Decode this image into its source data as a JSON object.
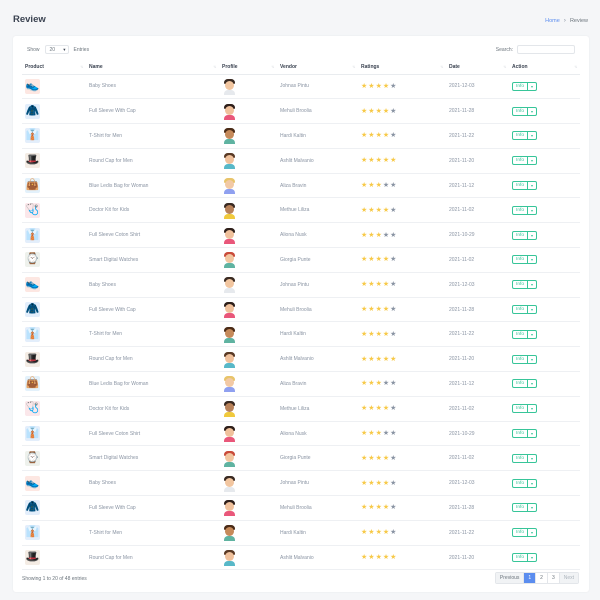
{
  "header": {
    "title": "Review",
    "breadcrumb_home": "Home",
    "breadcrumb_current": "Review"
  },
  "controls": {
    "show_label": "Show",
    "entries_label": "Entries",
    "page_size": "20",
    "search_label": "Search:"
  },
  "table": {
    "columns": [
      "Product",
      "Name",
      "Profile",
      "Vendor",
      "Ratings",
      "Date",
      "Action"
    ],
    "rows": [
      {
        "name": "Baby Shoes",
        "vendor": "Johnas Pintu",
        "rating": 4,
        "date": "2021-12-03",
        "product_icon": "shoe-icon",
        "avatar_icon": "man-beard-icon",
        "action": "Info"
      },
      {
        "name": "Full Sleeve With Cap",
        "vendor": "Mehuli Broolia",
        "rating": 4,
        "date": "2021-11-28",
        "product_icon": "hoodie-icon",
        "avatar_icon": "woman-icon",
        "action": "Info"
      },
      {
        "name": "T-Shirt for Men",
        "vendor": "Hardi Kaltin",
        "rating": 4,
        "date": "2021-11-22",
        "product_icon": "shirt-icon",
        "avatar_icon": "woman-curly-icon",
        "action": "Info"
      },
      {
        "name": "Round Cap for Men",
        "vendor": "Ashlit Malvanio",
        "rating": 5,
        "date": "2021-11-20",
        "product_icon": "hat-icon",
        "avatar_icon": "man-icon",
        "action": "Info"
      },
      {
        "name": "Blue Ledis Bag for Woman",
        "vendor": "Aliza Bravin",
        "rating": 3,
        "date": "2021-11-12",
        "product_icon": "bag-icon",
        "avatar_icon": "woman-blonde-icon",
        "action": "Info"
      },
      {
        "name": "Doctor Kit for Kids",
        "vendor": "Methue Liliza",
        "rating": 4,
        "date": "2021-11-02",
        "product_icon": "stethoscope-icon",
        "avatar_icon": "man-yellow-icon",
        "action": "Info"
      },
      {
        "name": "Full Sleeve Coton Shirt",
        "vendor": "Aliona Nusk",
        "rating": 3,
        "date": "2021-10-29",
        "product_icon": "shirt-icon",
        "avatar_icon": "woman-icon",
        "action": "Info"
      },
      {
        "name": "Smart Digital Watches",
        "vendor": "Giorgia Punte",
        "rating": 4,
        "date": "2021-11-02",
        "product_icon": "watch-icon",
        "avatar_icon": "man-red-icon",
        "action": "Info"
      },
      {
        "name": "Baby Shoes",
        "vendor": "Johnas Pintu",
        "rating": 4,
        "date": "2021-12-03",
        "product_icon": "shoe-icon",
        "avatar_icon": "man-beard-icon",
        "action": "Info"
      },
      {
        "name": "Full Sleeve With Cap",
        "vendor": "Mehuli Broolia",
        "rating": 4,
        "date": "2021-11-28",
        "product_icon": "hoodie-icon",
        "avatar_icon": "woman-icon",
        "action": "Info"
      },
      {
        "name": "T-Shirt for Men",
        "vendor": "Hardi Kaltin",
        "rating": 4,
        "date": "2021-11-22",
        "product_icon": "shirt-icon",
        "avatar_icon": "woman-curly-icon",
        "action": "Info"
      },
      {
        "name": "Round Cap for Men",
        "vendor": "Ashlit Malvanio",
        "rating": 5,
        "date": "2021-11-20",
        "product_icon": "hat-icon",
        "avatar_icon": "man-icon",
        "action": "Info"
      },
      {
        "name": "Blue Ledis Bag for Woman",
        "vendor": "Aliza Bravin",
        "rating": 3,
        "date": "2021-11-12",
        "product_icon": "bag-icon",
        "avatar_icon": "woman-blonde-icon",
        "action": "Info"
      },
      {
        "name": "Doctor Kit for Kids",
        "vendor": "Methue Liliza",
        "rating": 4,
        "date": "2021-11-02",
        "product_icon": "stethoscope-icon",
        "avatar_icon": "man-yellow-icon",
        "action": "Info"
      },
      {
        "name": "Full Sleeve Coton Shirt",
        "vendor": "Aliona Nusk",
        "rating": 3,
        "date": "2021-10-29",
        "product_icon": "shirt-icon",
        "avatar_icon": "woman-icon",
        "action": "Info"
      },
      {
        "name": "Smart Digital Watches",
        "vendor": "Giorgia Punte",
        "rating": 4,
        "date": "2021-11-02",
        "product_icon": "watch-icon",
        "avatar_icon": "man-red-icon",
        "action": "Info"
      },
      {
        "name": "Baby Shoes",
        "vendor": "Johnas Pintu",
        "rating": 4,
        "date": "2021-12-03",
        "product_icon": "shoe-icon",
        "avatar_icon": "man-beard-icon",
        "action": "Info"
      },
      {
        "name": "Full Sleeve With Cap",
        "vendor": "Mehuli Broolia",
        "rating": 4,
        "date": "2021-11-28",
        "product_icon": "hoodie-icon",
        "avatar_icon": "woman-icon",
        "action": "Info"
      },
      {
        "name": "T-Shirt for Men",
        "vendor": "Hardi Kaltin",
        "rating": 4,
        "date": "2021-11-22",
        "product_icon": "shirt-icon",
        "avatar_icon": "woman-curly-icon",
        "action": "Info"
      },
      {
        "name": "Round Cap for Men",
        "vendor": "Ashlit Malvanio",
        "rating": 5,
        "date": "2021-11-20",
        "product_icon": "hat-icon",
        "avatar_icon": "man-icon",
        "action": "Info"
      }
    ]
  },
  "footer": {
    "info": "Showing 1 to 20 of 48 entries",
    "previous": "Previous",
    "pages": [
      "1",
      "2",
      "3"
    ],
    "active_page": "1",
    "next": "Next"
  },
  "colors": {
    "accent": "#5b8def",
    "success": "#37c599",
    "star": "#f7c948",
    "star_off": "#8a94a3"
  }
}
